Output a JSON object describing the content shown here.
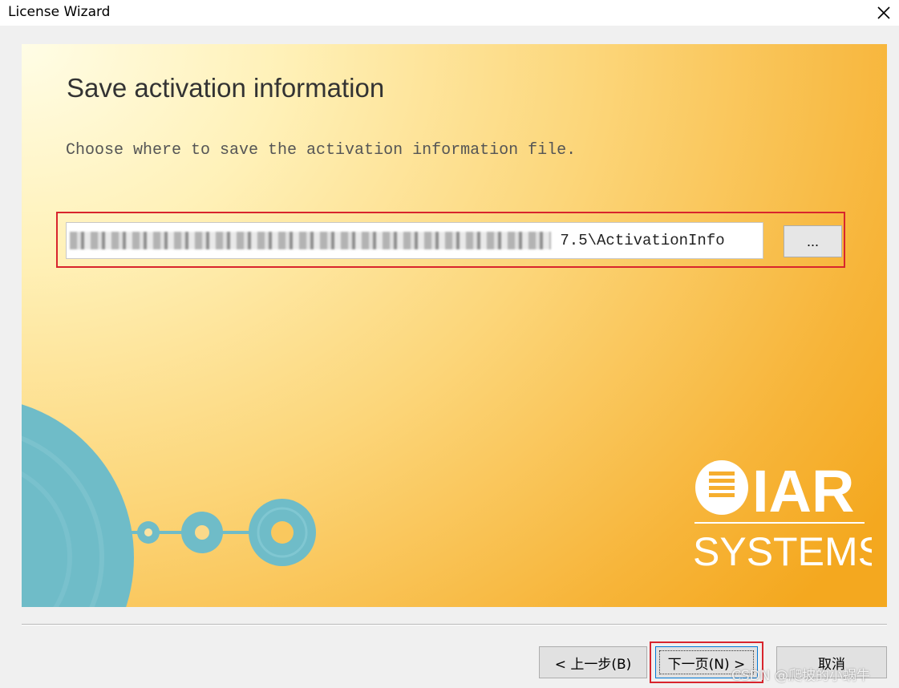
{
  "window": {
    "title": "License Wizard",
    "close_icon": "close-icon"
  },
  "page": {
    "heading": "Save activation information",
    "instruction": "Choose where to save the activation information file.",
    "path_value_visible": "7.5\\ActivationInfo",
    "browse_label": "..."
  },
  "buttons": {
    "back": "< 上一步(B)",
    "next": "下一页(N) >",
    "cancel": "取消"
  },
  "branding": {
    "logo_top": "IAR",
    "logo_bottom": "SYSTEMS"
  },
  "watermark": "CSDN @爬坡的小蜗牛",
  "colors": {
    "highlight": "#d8252d",
    "teal": "#6fbcc8"
  }
}
